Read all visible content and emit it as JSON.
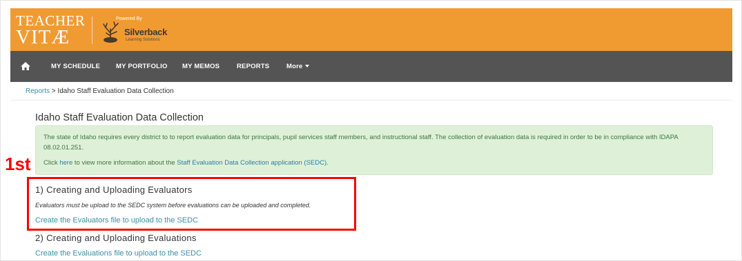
{
  "header": {
    "brand_line1": "TEACHER",
    "brand_line2": "VITÆ",
    "powered_by": "Powered By",
    "partner_name": "Silverback",
    "partner_sub": "Learning Solutions",
    "colors": {
      "header_bg": "#f09b32",
      "nav_bg": "#545454"
    }
  },
  "nav": {
    "home_icon": "home-icon",
    "items": [
      {
        "label": "MY SCHEDULE"
      },
      {
        "label": "MY PORTFOLIO"
      },
      {
        "label": "MY MEMOS"
      },
      {
        "label": "REPORTS"
      },
      {
        "label": "More"
      }
    ]
  },
  "breadcrumb": {
    "link": "Reports",
    "separator": ">",
    "current": "Idaho Staff Evaluation Data Collection"
  },
  "page": {
    "title": "Idaho Staff Evaluation Data Collection",
    "alert": {
      "text1": "The state of Idaho requires every district to to report evaluation data for principals, pupil services staff members, and instructional staff. The collection of evaluation data is required in order to be in compliance with IDAPA 08.02.01.251.",
      "text2_prefix": "Click",
      "text2_link1": "here",
      "text2_mid": "to view more information about the",
      "text2_link2": "Staff Evaluation Data Collection application (SEDC)",
      "text2_suffix": "."
    },
    "sections": [
      {
        "title": "1) Creating and Uploading Evaluators",
        "note": "Evaluators must be upload to the SEDC system before evaluations can be uploaded and completed.",
        "link": "Create the Evaluators file to upload to the SEDC"
      },
      {
        "title": "2) Creating and Uploading Evaluations",
        "link": "Create the Evaluations file to upload to the SEDC"
      }
    ]
  },
  "annotation": {
    "label": "1st",
    "color": "#ff0000"
  }
}
